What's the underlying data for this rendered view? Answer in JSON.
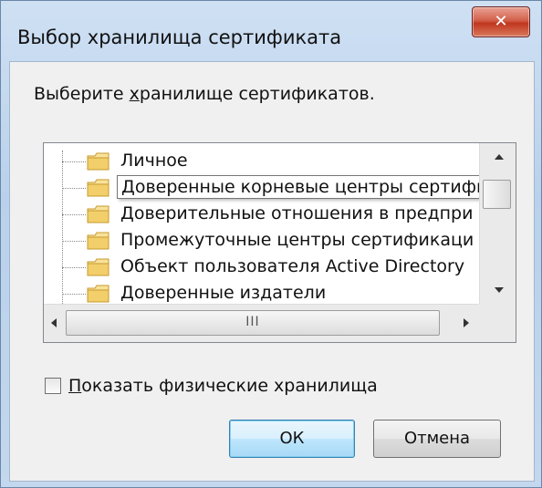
{
  "window": {
    "title": "Выбор хранилища сертификата",
    "close_glyph": "✕"
  },
  "prompt": {
    "before": "Выберите ",
    "underlined": "х",
    "after": "ранилище сертификатов."
  },
  "tree": {
    "items": [
      {
        "label": "Личное"
      },
      {
        "label": "Доверенные корневые центры сертификации"
      },
      {
        "label": "Доверительные отношения в предпри"
      },
      {
        "label": "Промежуточные центры сертификаци"
      },
      {
        "label": "Объект пользователя Active Directory"
      },
      {
        "label": "Доверенные издатели"
      }
    ],
    "item_icon": "folder-icon",
    "hscroll_grip": "III"
  },
  "checkbox": {
    "underlined": "П",
    "rest": "оказать физические хранилища",
    "checked": false
  },
  "buttons": {
    "ok": "ОК",
    "cancel": "Отмена"
  },
  "colors": {
    "title_bar": "#b9d1ec",
    "close_button": "#c0361e",
    "folder": "#f2d37a",
    "default_button_border": "#3c7fb1"
  }
}
